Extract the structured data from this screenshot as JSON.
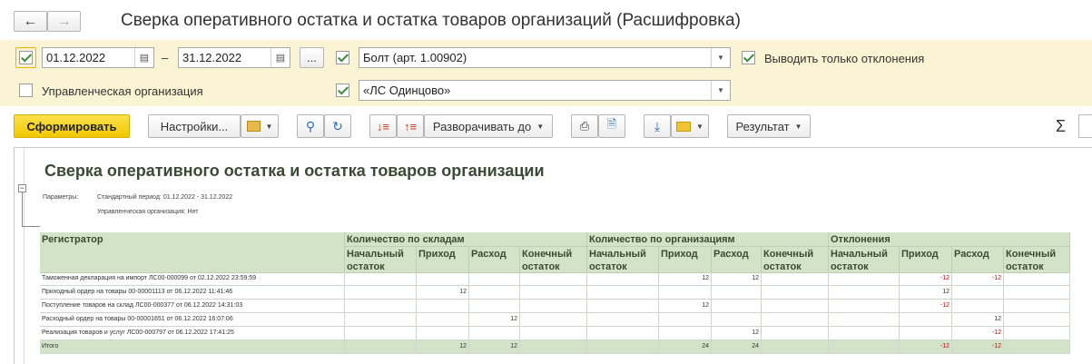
{
  "window": {
    "title": "Сверка оперативного остатка и остатка товаров организаций (Расшифровка)"
  },
  "filters": {
    "date_from": "01.12.2022",
    "date_dash": "–",
    "date_to": "31.12.2022",
    "ellipsis": "...",
    "product": "Болт (арт. 1.00902)",
    "only_deviations_label": "Выводить только отклонения",
    "mgmt_org_label": "Управленческая организация",
    "organization": "«ЛС Одинцово»"
  },
  "toolbar": {
    "generate": "Сформировать",
    "settings": "Настройки...",
    "expand_to": "Разворачивать до",
    "result": "Результат",
    "sigma": "Σ"
  },
  "report": {
    "title": "Сверка оперативного остатка и остатка товаров организации",
    "params_label": "Параметры:",
    "param_period": "Стандартный период: 01.12.2022 - 31.12.2022",
    "param_org": "Управленческая организация: Нет",
    "col_registrar": "Регистратор",
    "groups": [
      "Количество по складам",
      "Количество по организациям",
      "Отклонения"
    ],
    "subcols": [
      "Начальный остаток",
      "Приход",
      "Расход",
      "Конечный остаток"
    ],
    "rows": [
      {
        "name": "Таможенная декларация на импорт ЛС00-000099 от 02.12.2022 23:59:59",
        "vals": [
          "",
          "",
          "",
          "",
          "",
          "12",
          "12",
          "",
          "",
          "-12",
          "-12",
          ""
        ]
      },
      {
        "name": "Приходный ордер на товары 00-00001113 от 06.12.2022 11:41:46",
        "vals": [
          "",
          "12",
          "",
          "",
          "",
          "",
          "",
          "",
          "",
          "12",
          "",
          ""
        ]
      },
      {
        "name": "Поступление товаров на склад ЛС00-000377 от 06.12.2022 14:31:03",
        "vals": [
          "",
          "",
          "",
          "",
          "",
          "12",
          "",
          "",
          "",
          "-12",
          "",
          ""
        ]
      },
      {
        "name": "Расходный ордер на товары 00-00001651 от 06.12.2022 16:07:06",
        "vals": [
          "",
          "",
          "12",
          "",
          "",
          "",
          "",
          "",
          "",
          "",
          "12",
          ""
        ]
      },
      {
        "name": "Реализация товаров и услуг ЛС00-000797 от 06.12.2022 17:41:25",
        "vals": [
          "",
          "",
          "",
          "",
          "",
          "",
          "12",
          "",
          "",
          "",
          "-12",
          ""
        ]
      }
    ],
    "total": {
      "name": "Итого",
      "vals": [
        "",
        "12",
        "12",
        "",
        "",
        "24",
        "24",
        "",
        "",
        "-12",
        "-12",
        ""
      ]
    }
  },
  "colors": {
    "header_bg": "#d3e3c8",
    "accent_yellow": "#f5d10f",
    "negative": "#d00000"
  }
}
